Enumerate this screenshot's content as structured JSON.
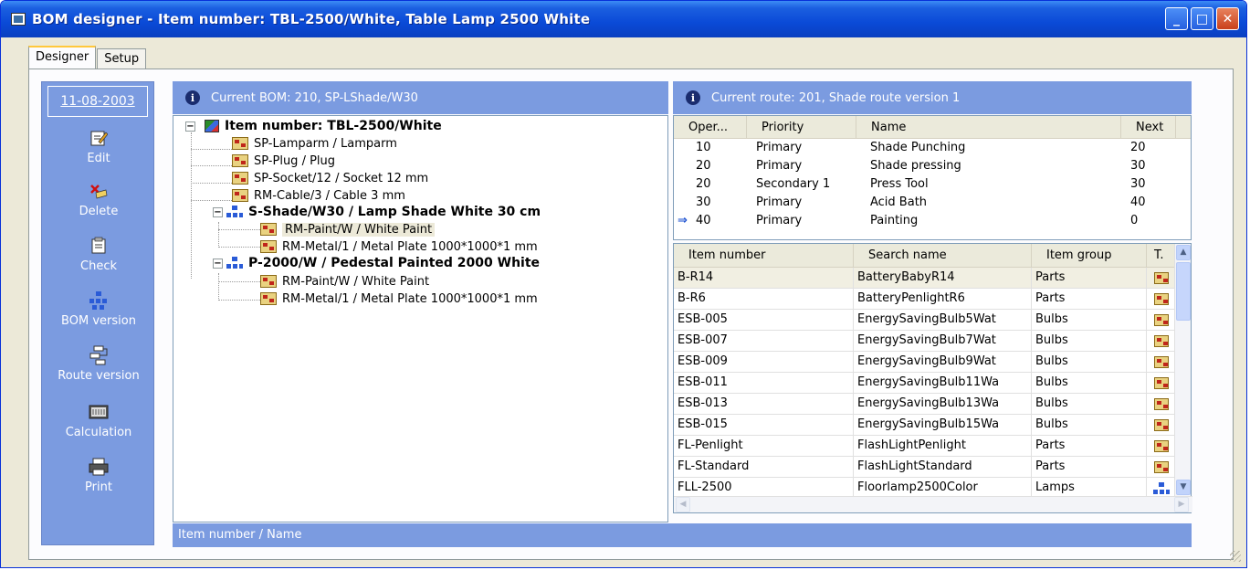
{
  "window": {
    "title": "BOM designer - Item number: TBL-2500/White, Table Lamp 2500 White",
    "minimize": "_",
    "maximize": "□",
    "close": "✕"
  },
  "tabs": [
    {
      "label": "Designer",
      "active": true
    },
    {
      "label": "Setup",
      "active": false
    }
  ],
  "sidebar": {
    "date": "11-08-2003",
    "actions": [
      {
        "label": "Edit",
        "icon": "edit-icon"
      },
      {
        "label": "Delete",
        "icon": "delete-icon"
      },
      {
        "label": "Check",
        "icon": "check-icon"
      },
      {
        "label": "BOM version",
        "icon": "bom-version-icon"
      },
      {
        "label": "Route version",
        "icon": "route-version-icon"
      },
      {
        "label": "Calculation",
        "icon": "calculation-icon"
      },
      {
        "label": "Print",
        "icon": "print-icon"
      }
    ]
  },
  "bom_panel": {
    "header": "Current BOM:  210, SP-LShade/W30",
    "tree": [
      {
        "label": "Item number: TBL-2500/White",
        "level": 0,
        "type": "root",
        "bold": true,
        "expanded": true
      },
      {
        "label": "SP-Lamparm / Lamparm",
        "level": 1,
        "type": "part"
      },
      {
        "label": "SP-Plug / Plug",
        "level": 1,
        "type": "part"
      },
      {
        "label": "SP-Socket/12 / Socket 12 mm",
        "level": 1,
        "type": "part"
      },
      {
        "label": "RM-Cable/3 / Cable 3 mm",
        "level": 1,
        "type": "part"
      },
      {
        "label": "S-Shade/W30 / Lamp Shade White 30 cm",
        "level": 1,
        "type": "bom",
        "bold": true,
        "expanded": true
      },
      {
        "label": "RM-Paint/W / White Paint",
        "level": 2,
        "type": "part",
        "selected": true
      },
      {
        "label": "RM-Metal/1 / Metal Plate 1000*1000*1 mm",
        "level": 2,
        "type": "part"
      },
      {
        "label": "P-2000/W / Pedestal Painted 2000 White",
        "level": 1,
        "type": "bom",
        "bold": true,
        "expanded": true
      },
      {
        "label": "RM-Paint/W / White Paint",
        "level": 2,
        "type": "part"
      },
      {
        "label": "RM-Metal/1 / Metal Plate 1000*1000*1 mm",
        "level": 2,
        "type": "part"
      }
    ],
    "expander_symbol": "−"
  },
  "route_panel": {
    "header": "Current route:  201, Shade route version 1",
    "columns": [
      "Oper...",
      "Priority",
      "Name",
      "Next"
    ],
    "rows": [
      {
        "oper": "10",
        "priority": "Primary",
        "name": "Shade Punching",
        "next": "20",
        "current": false
      },
      {
        "oper": "20",
        "priority": "Primary",
        "name": "Shade pressing",
        "next": "30",
        "current": false
      },
      {
        "oper": "20",
        "priority": "Secondary 1",
        "name": "Press Tool",
        "next": "30",
        "current": false
      },
      {
        "oper": "30",
        "priority": "Primary",
        "name": "Acid Bath",
        "next": "40",
        "current": false
      },
      {
        "oper": "40",
        "priority": "Primary",
        "name": "Painting",
        "next": "0",
        "current": true
      }
    ],
    "current_marker": "⇒"
  },
  "items_grid": {
    "columns": [
      "Item number",
      "Search name",
      "Item group",
      "T."
    ],
    "rows": [
      {
        "item": "B-R14",
        "search": "BatteryBabyR14",
        "group": "Parts",
        "type": "part"
      },
      {
        "item": "B-R6",
        "search": "BatteryPenlightR6",
        "group": "Parts",
        "type": "part"
      },
      {
        "item": "ESB-005",
        "search": "EnergySavingBulb5Wat",
        "group": "Bulbs",
        "type": "part"
      },
      {
        "item": "ESB-007",
        "search": "EnergySavingBulb7Wat",
        "group": "Bulbs",
        "type": "part"
      },
      {
        "item": "ESB-009",
        "search": "EnergySavingBulb9Wat",
        "group": "Bulbs",
        "type": "part"
      },
      {
        "item": "ESB-011",
        "search": "EnergySavingBulb11Wa",
        "group": "Bulbs",
        "type": "part"
      },
      {
        "item": "ESB-013",
        "search": "EnergySavingBulb13Wa",
        "group": "Bulbs",
        "type": "part"
      },
      {
        "item": "ESB-015",
        "search": "EnergySavingBulb15Wa",
        "group": "Bulbs",
        "type": "part"
      },
      {
        "item": "FL-Penlight",
        "search": "FlashLightPenlight",
        "group": "Parts",
        "type": "part"
      },
      {
        "item": "FL-Standard",
        "search": "FlashLightStandard",
        "group": "Parts",
        "type": "part"
      },
      {
        "item": "FLL-2500",
        "search": "Floorlamp2500Color",
        "group": "Lamps",
        "type": "bom"
      }
    ],
    "scroll_up": "▲",
    "scroll_down": "▼",
    "scroll_left": "◀",
    "scroll_right": "▶"
  },
  "status": {
    "text": "Item number / Name"
  }
}
